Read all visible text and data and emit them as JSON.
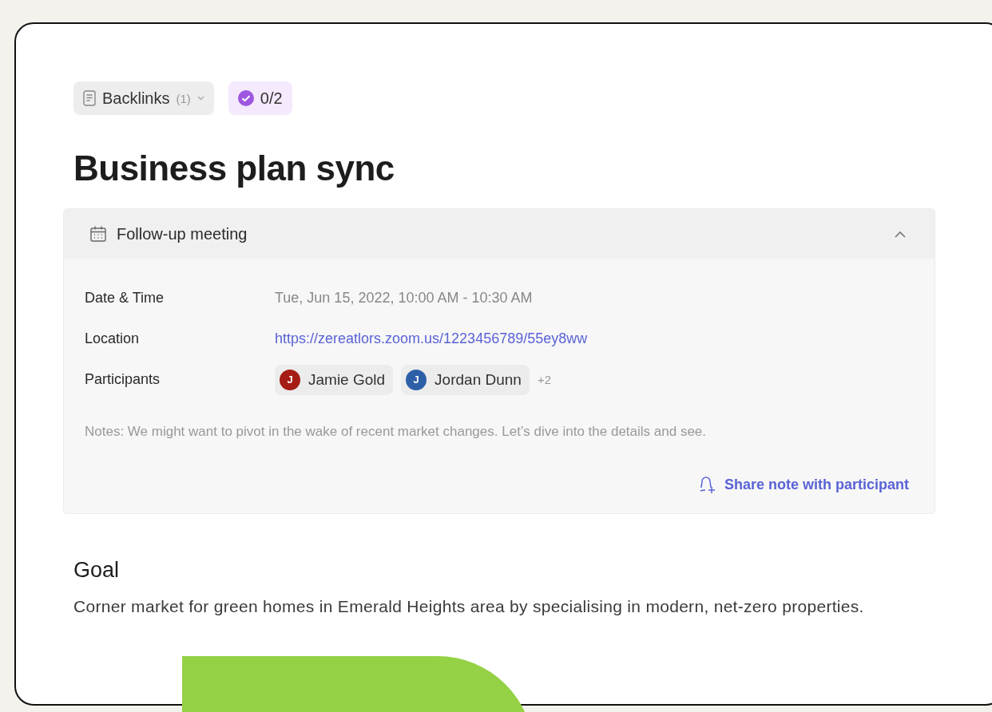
{
  "backlinks": {
    "label": "Backlinks",
    "count": "(1)"
  },
  "tasks": {
    "progress": "0/2"
  },
  "title": "Business plan sync",
  "meeting": {
    "title": "Follow-up meeting",
    "expanded": true,
    "fields": [
      {
        "kind": "text",
        "label": "Date & Time",
        "value": "Tue, Jun 15, 2022, 10:00 AM - 10:30 AM"
      },
      {
        "kind": "link",
        "label": "Location",
        "value": "https://zereatlors.zoom.us/1223456789/55ey8ww"
      },
      {
        "kind": "people",
        "label": "Participants",
        "participants": [
          {
            "initial": "J",
            "name": "Jamie Gold",
            "color": "#a51d14"
          },
          {
            "initial": "J",
            "name": "Jordan Dunn",
            "color": "#2d5fa8"
          }
        ],
        "more": "+2"
      }
    ],
    "notes": "Notes: We might want to pivot in the wake of recent market changes. Let’s dive into the details and see.",
    "share_action": "Share note with participant"
  },
  "goal": {
    "heading": "Goal",
    "text": "Corner market for green homes in Emerald Heights area by specialising in modern, net-zero properties."
  }
}
